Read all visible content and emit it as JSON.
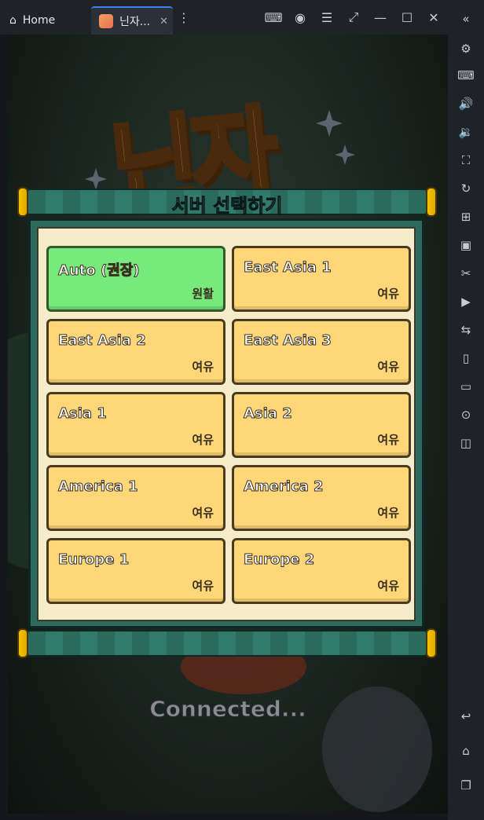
{
  "tabs": [
    {
      "label": "Home",
      "icon": "home-icon"
    },
    {
      "label": "닌자...",
      "icon": "game-app-icon"
    }
  ],
  "game": {
    "logo_text": "닌자",
    "dialog_title": "서버 선택하기",
    "servers": [
      {
        "name": "Auto (권장)",
        "status": "원활",
        "selected": true
      },
      {
        "name": "East Asia 1",
        "status": "여유"
      },
      {
        "name": "East Asia 2",
        "status": "여유"
      },
      {
        "name": "East Asia 3",
        "status": "여유"
      },
      {
        "name": "Asia 1",
        "status": "여유"
      },
      {
        "name": "Asia 2",
        "status": "여유"
      },
      {
        "name": "America 1",
        "status": "여유"
      },
      {
        "name": "America 2",
        "status": "여유"
      },
      {
        "name": "Europe 1",
        "status": "여유"
      },
      {
        "name": "Europe 2",
        "status": "여유"
      }
    ],
    "connection_status": "Connected..."
  },
  "colors": {
    "server_default": "#ffd778",
    "server_selected": "#77e97d",
    "banner": "#2a6b5e",
    "accent_yellow": "#f5c400"
  }
}
